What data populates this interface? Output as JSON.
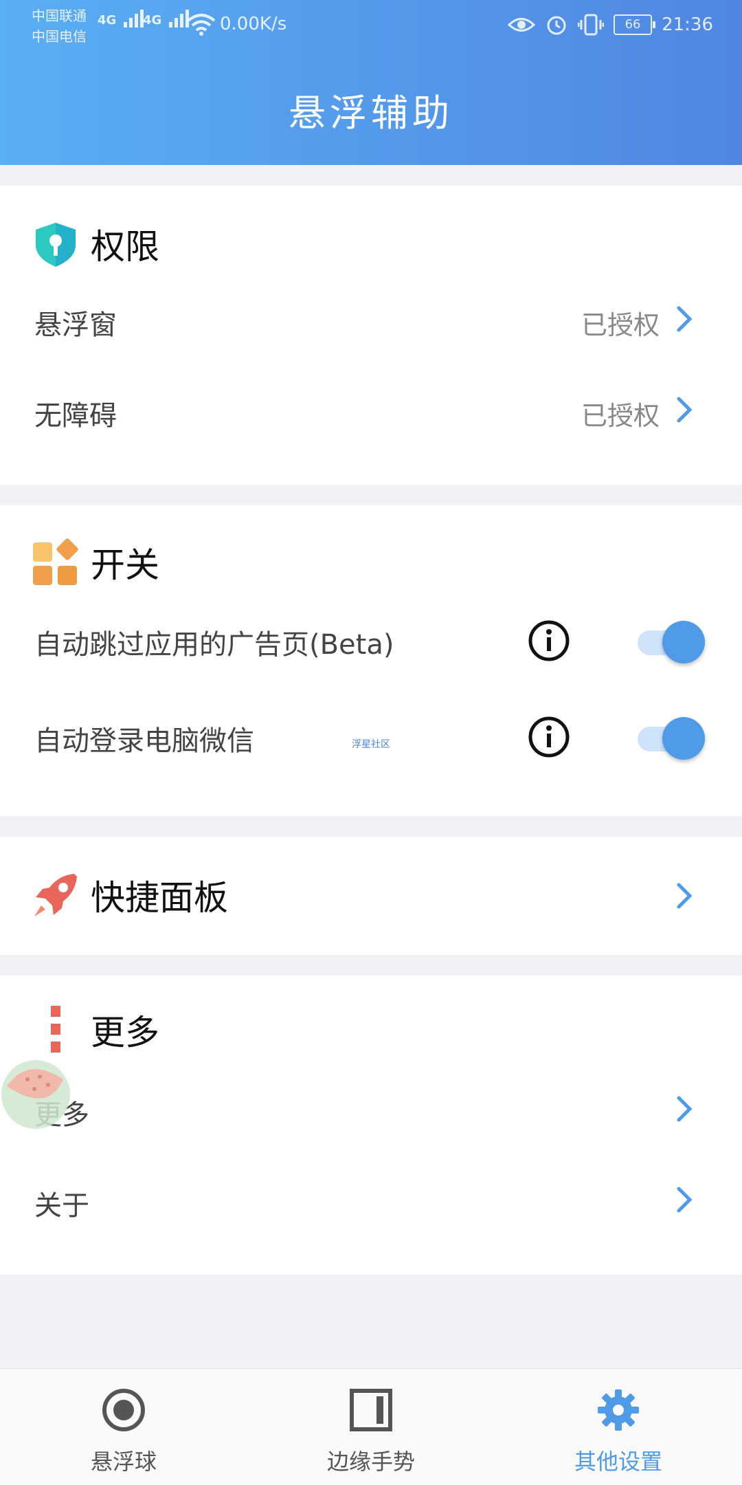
{
  "status_bar": {
    "carrier_1": "中国联通",
    "carrier_2": "中国电信",
    "network_1": "4G",
    "network_2": "4G",
    "speed": "0.00K/s",
    "battery": "66",
    "time": "21:36"
  },
  "header": {
    "title": "悬浮辅助"
  },
  "permissions": {
    "title": "权限",
    "items": [
      {
        "label": "悬浮窗",
        "value": "已授权"
      },
      {
        "label": "无障碍",
        "value": "已授权"
      }
    ]
  },
  "switches": {
    "title": "开关",
    "items": [
      {
        "label": "自动跳过应用的广告页(Beta)",
        "enabled": true
      },
      {
        "label": "自动登录电脑微信",
        "enabled": true
      }
    ]
  },
  "watermark": "浮星社区",
  "quick_panel": {
    "title": "快捷面板"
  },
  "more": {
    "title": "更多",
    "items": [
      {
        "label": "更多"
      },
      {
        "label": "关于"
      }
    ]
  },
  "tabs": [
    {
      "label": "悬浮球",
      "icon": "record-icon",
      "active": false
    },
    {
      "label": "边缘手势",
      "icon": "edge-panel-icon",
      "active": false
    },
    {
      "label": "其他设置",
      "icon": "gear-icon",
      "active": true
    }
  ],
  "colors": {
    "accent": "#4f9be8",
    "header_start": "#5aaef4",
    "header_end": "#4f86e2"
  }
}
